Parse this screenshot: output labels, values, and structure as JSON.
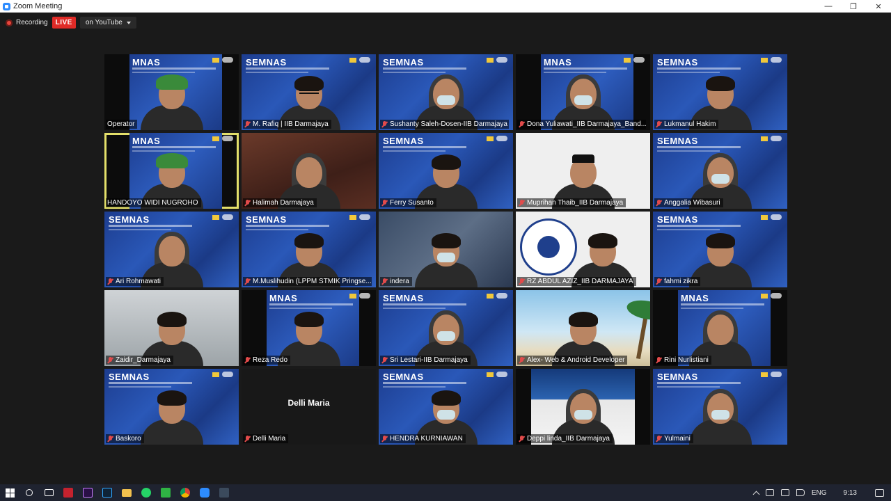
{
  "window": {
    "title": "Zoom Meeting",
    "controls": [
      "minimize",
      "maximize",
      "close"
    ]
  },
  "recording": {
    "label": "Recording",
    "live_badge": "LIVE",
    "stream_target": "on YouTube"
  },
  "participants": [
    {
      "name": "Operator",
      "muted": false,
      "tile": "semnas-narrow",
      "look": "cap-green"
    },
    {
      "name": "M. Rafiq | IIB Darmajaya",
      "muted": true,
      "tile": "semnas",
      "look": "glasses"
    },
    {
      "name": "Sushanty Saleh-Dosen-IIB Darmajaya",
      "muted": true,
      "tile": "semnas",
      "look": "hijab-mask"
    },
    {
      "name": "Dona Yuliawati_IIB Darmajaya_Band...",
      "muted": true,
      "tile": "semnas-narrow",
      "look": "hijab-mask"
    },
    {
      "name": "Lukmanul Hakim",
      "muted": true,
      "tile": "semnas",
      "look": "man"
    },
    {
      "name": "HANDOYO WIDI NUGROHO",
      "muted": false,
      "tile": "semnas-narrow",
      "look": "cap-green",
      "active_speaker": true
    },
    {
      "name": "Halimah Darmajaya",
      "muted": true,
      "tile": "room",
      "look": "hijab"
    },
    {
      "name": "Ferry Susanto",
      "muted": true,
      "tile": "semnas",
      "look": "man"
    },
    {
      "name": "Muprihan Thaib_IIB Darmajaya",
      "muted": true,
      "tile": "white",
      "look": "peci"
    },
    {
      "name": "Anggalia Wibasuri",
      "muted": true,
      "tile": "semnas",
      "look": "hijab-mask"
    },
    {
      "name": "Ari Rohmawati",
      "muted": true,
      "tile": "semnas",
      "look": "hijab"
    },
    {
      "name": "M.Muslihudin (LPPM STMIK Pringse...",
      "muted": true,
      "tile": "semnas",
      "look": "man"
    },
    {
      "name": "indera",
      "muted": true,
      "tile": "mixed",
      "look": "mask"
    },
    {
      "name": "RZ ABDUL AZIZ_IIB DARMAJAYA",
      "muted": true,
      "tile": "crest",
      "look": "man"
    },
    {
      "name": "fahmi zikra",
      "muted": true,
      "tile": "semnas",
      "look": "man"
    },
    {
      "name": "Zaidir_Darmajaya",
      "muted": true,
      "tile": "grey",
      "look": "man"
    },
    {
      "name": "Reza Redo",
      "muted": true,
      "tile": "semnas-narrow",
      "look": "man"
    },
    {
      "name": "Sri Lestari-IIB Darmajaya",
      "muted": true,
      "tile": "semnas",
      "look": "hijab-mask"
    },
    {
      "name": "Alex- Web & Android Developer",
      "muted": true,
      "tile": "beach",
      "look": "man"
    },
    {
      "name": "Rini Nurlistiani",
      "muted": true,
      "tile": "semnas-narrow",
      "look": "hijab"
    },
    {
      "name": "Baskoro",
      "muted": true,
      "tile": "semnas",
      "look": "man"
    },
    {
      "name": "Delli Maria",
      "muted": true,
      "tile": "name-only",
      "look": "none",
      "display_name": "Delli Maria"
    },
    {
      "name": "HENDRA KURNIAWAN",
      "muted": true,
      "tile": "semnas",
      "look": "mask"
    },
    {
      "name": "Deppi linda_IIB Darmajaya",
      "muted": true,
      "tile": "poster",
      "look": "hijab-mask"
    },
    {
      "name": "Yulmaini",
      "muted": true,
      "tile": "semnas",
      "look": "hijab-mask"
    }
  ],
  "background_text": {
    "semnas": "SEMNAS",
    "semnas_cropped": "MNAS"
  },
  "taskbar": {
    "apps": [
      "start",
      "search",
      "task-view",
      "app-red",
      "premiere",
      "photoshop",
      "file-explorer",
      "whatsapp",
      "app-green",
      "chrome",
      "zoom",
      "app-terminal"
    ],
    "tray": {
      "language": "ENG",
      "time": "9:13"
    }
  },
  "colors": {
    "live": "#e02b27",
    "active_speaker_border": "#e4e06a",
    "muted_icon": "#e24b4b",
    "meeting_bg": "#1a1a1a",
    "taskbar_bg": "#1f2330"
  }
}
